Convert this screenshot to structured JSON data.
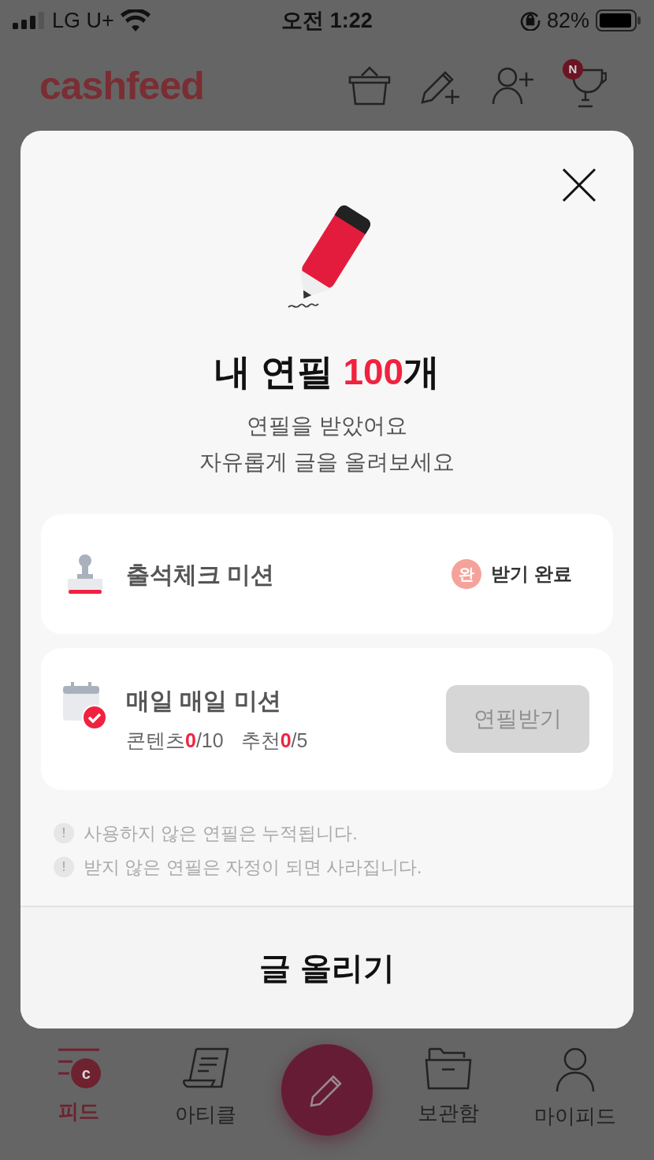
{
  "status_bar": {
    "carrier": "LG U+",
    "time": "오전 1:22",
    "battery": "82%"
  },
  "header": {
    "logo": "cashfeed",
    "trophy_badge": "N"
  },
  "modal": {
    "title_prefix": "내 연필 ",
    "count": "100",
    "title_suffix": "개",
    "subtitle": [
      "연필을 받았어요",
      "자유롭게 글을 올려보세요"
    ],
    "missions": [
      {
        "kind": "completed",
        "title": "출석체크 미션",
        "badge": "완",
        "status": "받기 완료"
      },
      {
        "kind": "claim",
        "title": "매일 매일 미션",
        "progress": [
          {
            "label": "콘텐츠",
            "current": "0",
            "total": "/10"
          },
          {
            "label": "추천",
            "current": "0",
            "total": "/5"
          }
        ],
        "button": {
          "label": "연필받기",
          "disabled": true
        }
      }
    ],
    "notes": [
      {
        "icon": "!",
        "text": "사용하지 않은 연필은 누적됩니다."
      },
      {
        "icon": "!",
        "text": "받지 않은 연필은 자정이 되면 사라집니다."
      }
    ],
    "primary_button": "글 올리기"
  },
  "bottom_nav": [
    {
      "kind": "feed",
      "label": "피드",
      "badge": "c",
      "selected": true
    },
    {
      "kind": "article",
      "label": "아티클",
      "selected": false
    },
    {
      "kind": "write",
      "selected": false
    },
    {
      "kind": "folder",
      "label": "보관함",
      "selected": false
    },
    {
      "kind": "profile",
      "label": "마이피드",
      "selected": false
    }
  ]
}
